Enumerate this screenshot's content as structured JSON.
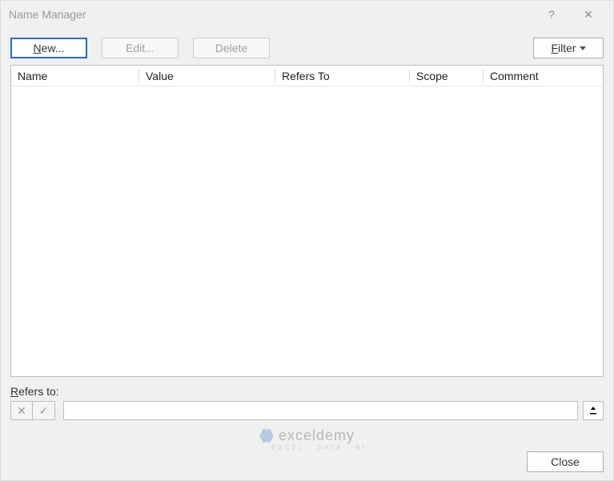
{
  "window": {
    "title": "Name Manager",
    "help_icon": "?",
    "close_icon": "✕"
  },
  "toolbar": {
    "new_prefix": "N",
    "new_suffix": "ew...",
    "edit_label": "Edit...",
    "delete_label": "Delete",
    "filter_prefix": "F",
    "filter_suffix": "ilter"
  },
  "columns": {
    "name": "Name",
    "value": "Value",
    "refers_to": "Refers To",
    "scope": "Scope",
    "comment": "Comment"
  },
  "rows": [],
  "refers_to": {
    "label_prefix": "R",
    "label_suffix": "efers to:",
    "value": ""
  },
  "footer": {
    "close_label": "Close"
  },
  "watermark": {
    "brand": "exceldemy",
    "tagline": "EXCEL · DATA · BI"
  }
}
